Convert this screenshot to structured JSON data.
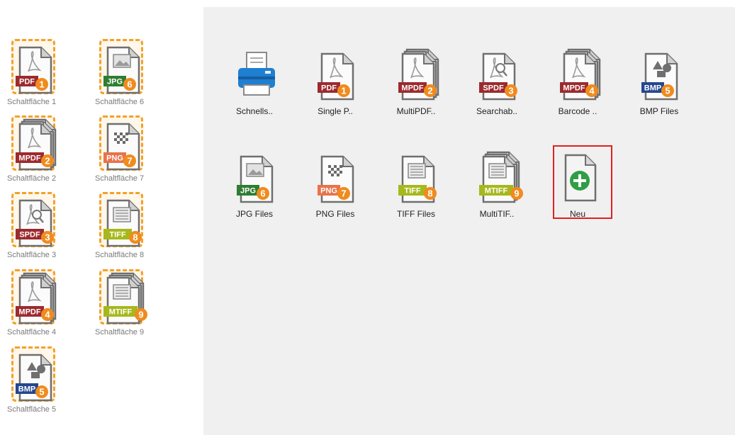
{
  "left_buttons": [
    {
      "id": "pdf",
      "tag": "PDF",
      "number": "1",
      "label": "Schaltfläche 1"
    },
    {
      "id": "jpg",
      "tag": "JPG",
      "number": "6",
      "label": "Schaltfläche 6"
    },
    {
      "id": "mpdf",
      "tag": "MPDF",
      "number": "2",
      "label": "Schaltfläche 2"
    },
    {
      "id": "png",
      "tag": "PNG",
      "number": "7",
      "label": "Schaltfläche 7"
    },
    {
      "id": "spdf",
      "tag": "SPDF",
      "number": "3",
      "label": "Schaltfläche 3"
    },
    {
      "id": "tiff",
      "tag": "TIFF",
      "number": "8",
      "label": "Schaltfläche 8"
    },
    {
      "id": "mpdf-barcode",
      "tag": "MPDF",
      "number": "4",
      "label": "Schaltfläche 4"
    },
    {
      "id": "mtiff",
      "tag": "MTIFF",
      "number": "9",
      "label": "Schaltfläche 9"
    },
    {
      "id": "bmp",
      "tag": "BMP",
      "number": "5",
      "label": "Schaltfläche 5"
    }
  ],
  "right_buttons": [
    {
      "id": "scanner",
      "label": "Schnells.."
    },
    {
      "id": "pdf",
      "tag": "PDF",
      "number": "1",
      "label": "Single P.."
    },
    {
      "id": "mpdf",
      "tag": "MPDF",
      "number": "2",
      "label": "MultiPDF.."
    },
    {
      "id": "spdf",
      "tag": "SPDF",
      "number": "3",
      "label": "Searchab.."
    },
    {
      "id": "mpdf-barcode",
      "tag": "MPDF",
      "number": "4",
      "label": "Barcode .."
    },
    {
      "id": "bmp",
      "tag": "BMP",
      "number": "5",
      "label": "BMP Files"
    },
    {
      "id": "jpg",
      "tag": "JPG",
      "number": "6",
      "label": "JPG Files"
    },
    {
      "id": "png",
      "tag": "PNG",
      "number": "7",
      "label": "PNG Files"
    },
    {
      "id": "tiff",
      "tag": "TIFF",
      "number": "8",
      "label": "TIFF Files"
    },
    {
      "id": "mtiff",
      "tag": "MTIFF",
      "number": "9",
      "label": "MultiTIF.."
    },
    {
      "id": "new",
      "label": "Neu",
      "selected": true
    }
  ],
  "colors": {
    "tag_pdf": "#9c2a2e",
    "tag_jpg": "#2f7d32",
    "tag_png": "#e8734a",
    "tag_tiff": "#a6b81c",
    "tag_bmp": "#24478f",
    "number_badge": "#f08b1d",
    "selection_border": "#e02020",
    "add_green": "#2f9e44",
    "scanner_blue": "#1f7fd1"
  },
  "icons": {
    "pdf": "document-acrobat-icon",
    "mpdf": "multi-document-acrobat-icon",
    "spdf": "document-search-icon",
    "jpg": "document-image-icon",
    "png": "document-checker-icon",
    "tiff": "document-lines-icon",
    "mtiff": "multi-document-lines-icon",
    "bmp": "document-shapes-icon",
    "scanner": "printer-scanner-icon",
    "new": "add-plus-icon"
  }
}
